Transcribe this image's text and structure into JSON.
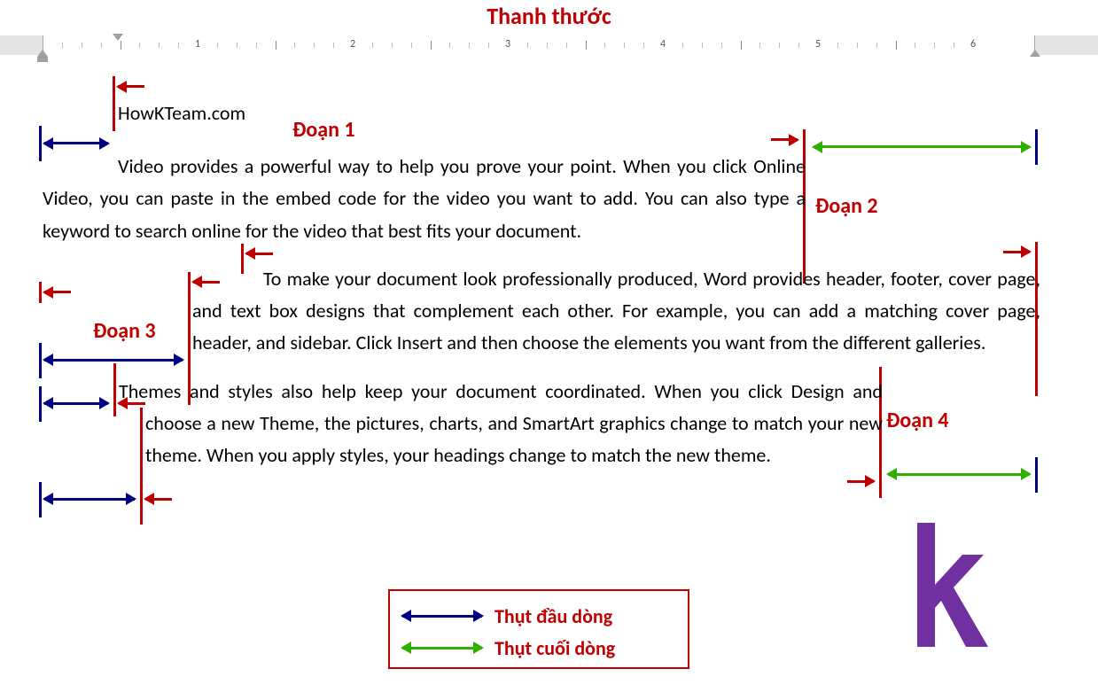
{
  "title": "Thanh thước",
  "ruler_numbers": [
    "1",
    "2",
    "3",
    "4",
    "5",
    "6"
  ],
  "paragraphs": {
    "p1": "HowKTeam.com",
    "p2": "Video provides a powerful way to help you prove your point. When you click Online Video, you can paste in the embed code for the video you want to add. You can also type a keyword to search online for the video that best fits your document.",
    "p3": "To make your document look professionally produced, Word provides header, footer, cover page, and text box designs that complement each other. For example, you can add a matching cover page, header, and sidebar. Click Insert and then choose the elements you want from the different galleries.",
    "p4": "Themes and styles also help keep your document coordinated. When you click Design and choose a new Theme, the pictures, charts, and SmartArt graphics change to match your new theme. When you apply styles, your headings change to match the new theme."
  },
  "labels": {
    "d1": "Đoạn 1",
    "d2": "Đoạn 2",
    "d3": "Đoạn 3",
    "d4": "Đoạn 4"
  },
  "legend": {
    "first": "Thụt đầu dòng",
    "last": "Thụt cuối dòng"
  }
}
